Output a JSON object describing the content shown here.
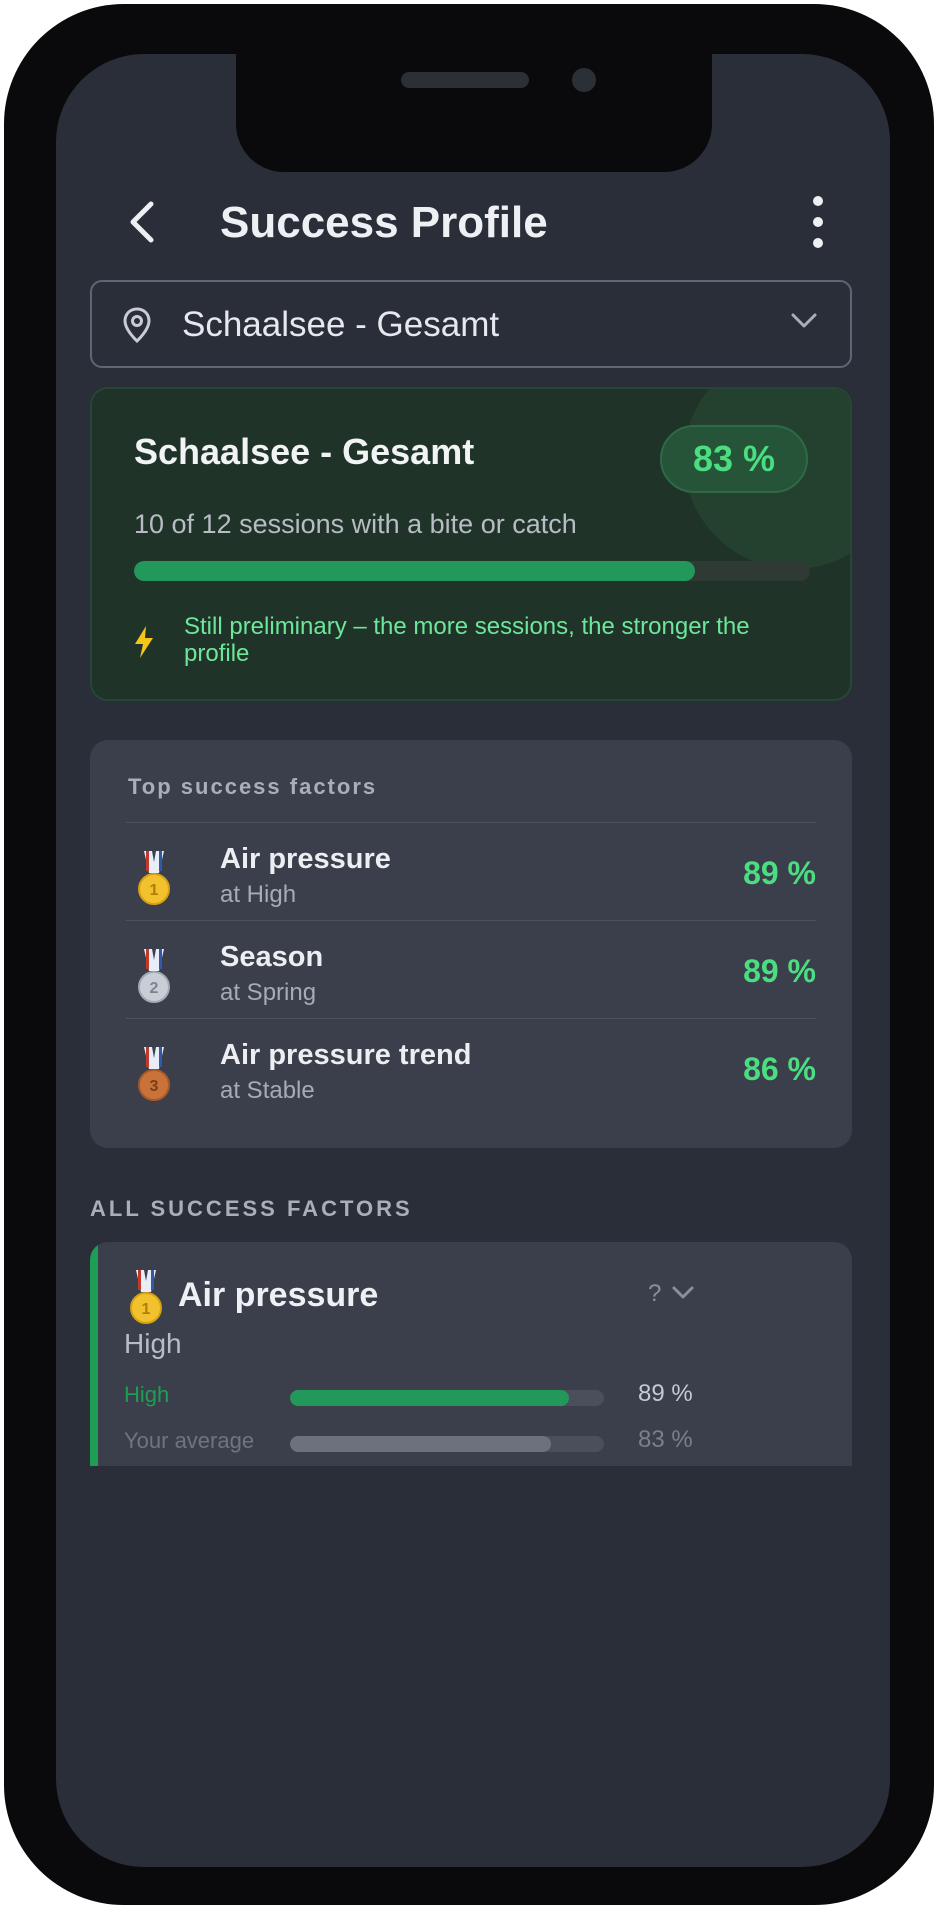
{
  "header": {
    "title": "Success Profile"
  },
  "location": {
    "selected": "Schaalsee - Gesamt"
  },
  "summary": {
    "title": "Schaalsee - Gesamt",
    "percent_label": "83 %",
    "sessions_text": "10 of 12 sessions with a bite or catch",
    "progress": 0.83,
    "hint": "Still preliminary – the more sessions, the stronger the profile"
  },
  "top_factors": {
    "heading": "Top success factors",
    "items": [
      {
        "name": "Air pressure",
        "sub": "at High",
        "percent": "89 %",
        "medal": "gold",
        "medal_num": "1"
      },
      {
        "name": "Season",
        "sub": "at Spring",
        "percent": "89 %",
        "medal": "silver",
        "medal_num": "2"
      },
      {
        "name": "Air pressure trend",
        "sub": "at Stable",
        "percent": "86 %",
        "medal": "bronze",
        "medal_num": "3"
      }
    ]
  },
  "all_factors": {
    "heading": "ALL SUCCESS FACTORS",
    "first": {
      "title": "Air pressure",
      "subtitle": "High",
      "help": "?",
      "medal_num": "1",
      "rows": [
        {
          "label": "High",
          "value": "89 %",
          "fraction": 0.89,
          "color": "#22995a",
          "label_color": "#1f9d55",
          "value_color": "#c5c9d0"
        },
        {
          "label": "Your average",
          "value": "83 %",
          "fraction": 0.83,
          "color": "#6c717c",
          "label_color": "#6f7480",
          "value_color": "#7a7f8a"
        }
      ]
    }
  },
  "colors": {
    "accent": "#4ade80",
    "background": "#2a2e38",
    "card": "#3a3f4b"
  }
}
